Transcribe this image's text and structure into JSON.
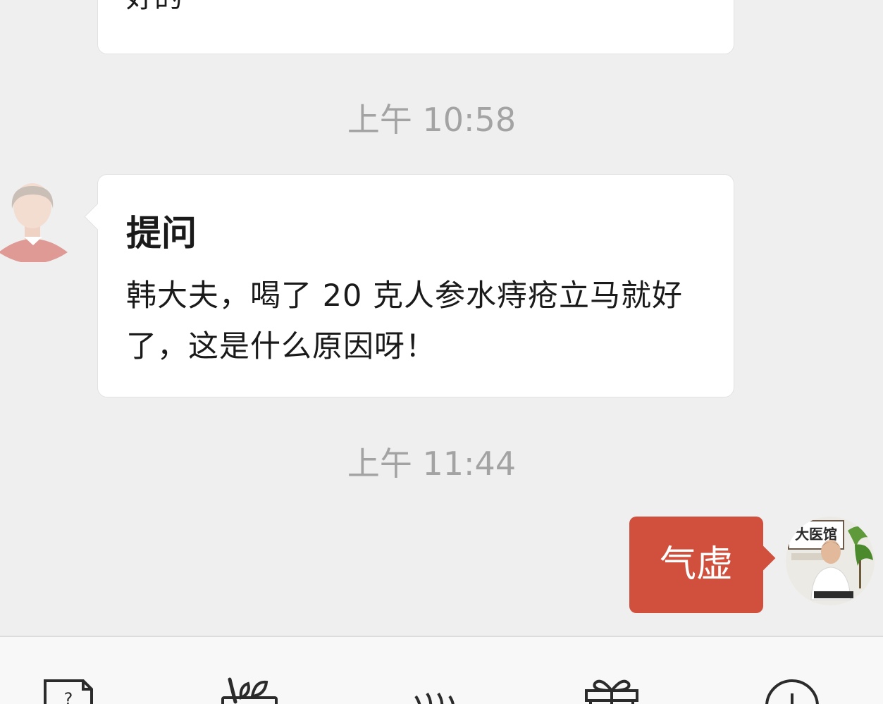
{
  "messages": {
    "previous": {
      "text": "好的"
    },
    "time_1": "上午 10:58",
    "question": {
      "title": "提问",
      "body": "韩大夫，喝了 20 克人参水痔疮立马就好了，这是什么原因呀！"
    },
    "time_2": "上午 11:44",
    "reply": {
      "text": "气虚"
    }
  },
  "colors": {
    "background": "#efefef",
    "reply_bubble": "#d0503d",
    "timestamp": "#a3a3a3"
  },
  "avatar_badge": "大医馆",
  "bottom_tabs": [
    {
      "icon": "question-document-icon"
    },
    {
      "icon": "herb-basket-icon"
    },
    {
      "icon": "steaming-bowl-icon"
    },
    {
      "icon": "gift-box-icon"
    },
    {
      "icon": "plus-circle-icon"
    }
  ]
}
